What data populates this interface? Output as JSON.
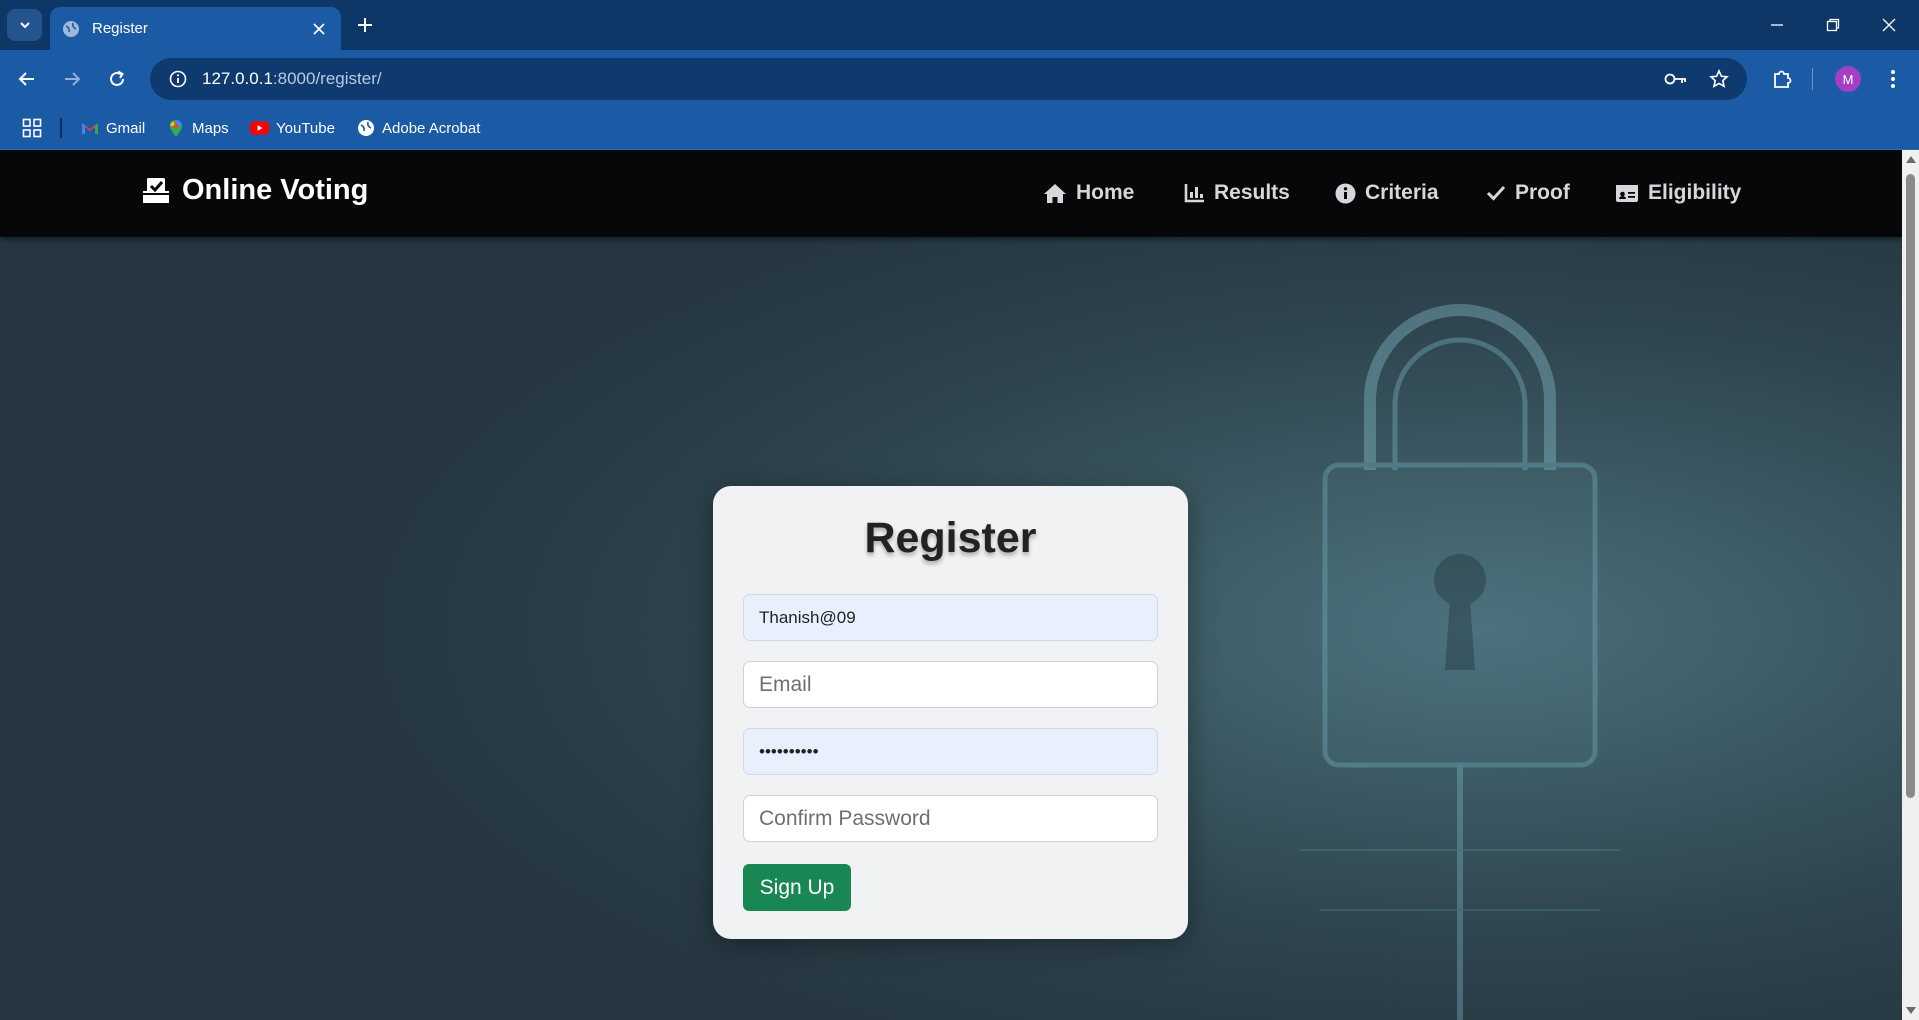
{
  "browser": {
    "tab_title": "Register",
    "url_host": "127.0.0.1",
    "url_rest": ":8000/register/",
    "profile_initial": "M",
    "bookmarks": [
      {
        "label": "Gmail",
        "icon": "gmail-icon"
      },
      {
        "label": "Maps",
        "icon": "maps-icon"
      },
      {
        "label": "YouTube",
        "icon": "youtube-icon"
      },
      {
        "label": "Adobe Acrobat",
        "icon": "globe-icon"
      }
    ]
  },
  "site": {
    "brand": "Online Voting",
    "menu": [
      {
        "label": "Home",
        "icon": "home-icon"
      },
      {
        "label": "Results",
        "icon": "bar-chart-icon"
      },
      {
        "label": "Criteria",
        "icon": "info-icon"
      },
      {
        "label": "Proof",
        "icon": "check-icon"
      },
      {
        "label": "Eligibility",
        "icon": "id-card-icon"
      }
    ]
  },
  "form": {
    "title": "Register",
    "username_value": "Thanish@09",
    "email_placeholder": "Email",
    "password_value": "••••••••••",
    "confirm_placeholder": "Confirm Password",
    "submit_label": "Sign Up"
  },
  "colors": {
    "chrome_tabbar": "#0c3766",
    "chrome_toolbar": "#1b5ba5",
    "site_nav": "#060709",
    "submit_button": "#198754",
    "autofill_bg": "#e8f0fe"
  }
}
